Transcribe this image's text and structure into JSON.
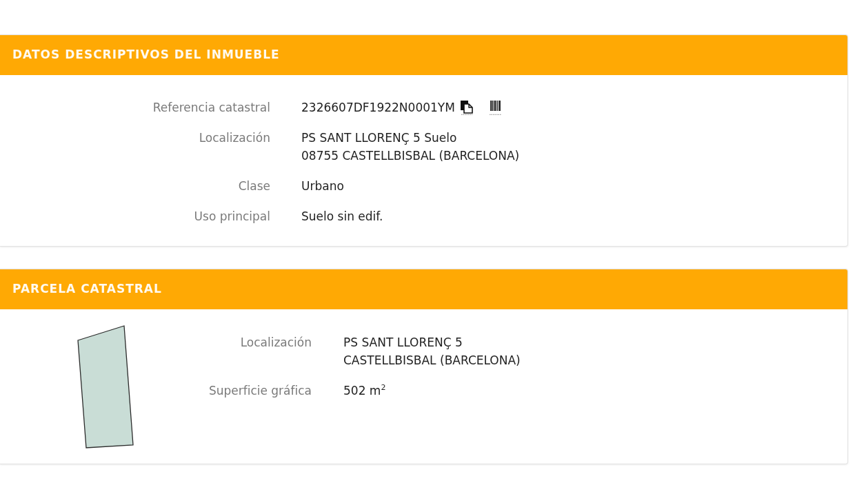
{
  "sections": [
    {
      "title": "DATOS DESCRIPTIVOS DEL INMUEBLE",
      "kind": "details",
      "fields": [
        {
          "label": "Referencia catastral",
          "kind": "reference",
          "lines": [
            "2326607DF1922N0001YM"
          ]
        },
        {
          "label": "Localización",
          "kind": "text",
          "lines": [
            "PS SANT LLORENÇ 5 Suelo",
            "08755 CASTELLBISBAL (BARCELONA)"
          ]
        },
        {
          "label": "Clase",
          "kind": "text",
          "lines": [
            "Urbano"
          ]
        },
        {
          "label": "Uso principal",
          "kind": "text",
          "lines": [
            "Suelo sin edif."
          ]
        }
      ]
    },
    {
      "title": "PARCELA CATASTRAL",
      "kind": "parcel",
      "fields": [
        {
          "label": "Localización",
          "kind": "text",
          "lines": [
            "PS SANT LLORENÇ 5",
            "CASTELLBISBAL (BARCELONA)"
          ]
        },
        {
          "label": "Superficie gráfica",
          "kind": "text",
          "lines": [
            "502 m$^{2}$"
          ]
        }
      ]
    }
  ]
}
